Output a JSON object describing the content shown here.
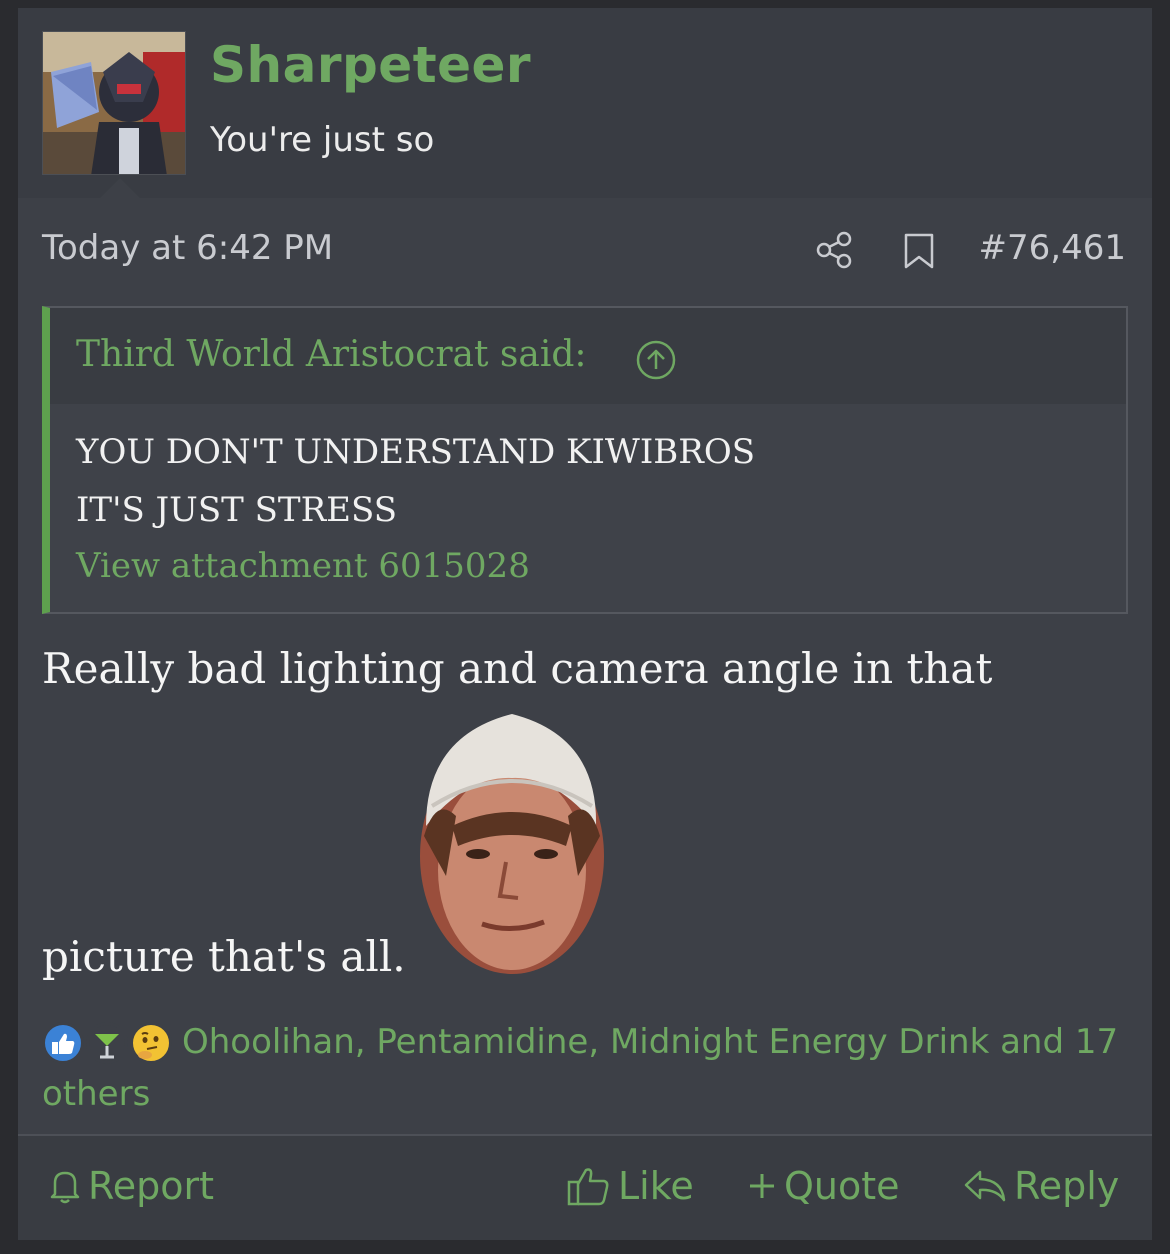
{
  "post": {
    "username": "Sharpeteer",
    "user_title": "You're just so",
    "date": "Today at 6:42 PM",
    "post_number": "#76,461",
    "quote": {
      "author_line": "Third World Aristocrat said:",
      "lines": [
        "YOU DON'T UNDERSTAND KIWIBROS",
        "IT'S JUST STRESS"
      ],
      "attachment_link": "View attachment 6015028"
    },
    "message": {
      "line1": "Really bad lighting and camera angle in that",
      "line2": "picture that's all."
    },
    "reactions": {
      "icons": [
        "like-icon",
        "cocktail-icon",
        "thinking-icon"
      ],
      "text": "Ohoolihan, Pentamidine, Midnight Energy Drink and 17 others"
    },
    "footer": {
      "report": "Report",
      "like": "Like",
      "quote": "Quote",
      "reply": "Reply"
    }
  },
  "colors": {
    "accent_green": "#6fa862",
    "quote_bar": "#5ea04e",
    "post_bg": "#3d4047"
  }
}
